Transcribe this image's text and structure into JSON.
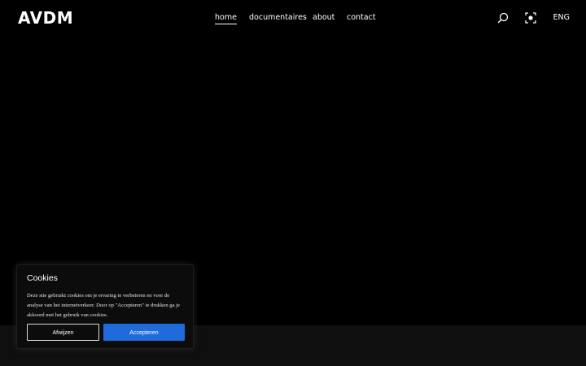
{
  "header": {
    "logo": "AVDM",
    "nav": [
      {
        "label": "home",
        "active": true
      },
      {
        "label": "documentaires",
        "active": false
      },
      {
        "label": "about",
        "active": false
      },
      {
        "label": "contact",
        "active": false
      }
    ],
    "tools": {
      "search_icon": "search-icon",
      "focus_icon": "focus-icon",
      "language": "ENG"
    }
  },
  "cookie": {
    "title": "Cookies",
    "text": "Deze site gebruikt cookies om je ervaring te verbeteren en voor de analyse van het internetverkeer. Door op \"Accepteren\" te drukken ga je akkoord met het gebruik van cookies.",
    "decline_label": "Afwijzen",
    "accept_label": "Accepteren"
  },
  "colors": {
    "background": "#000000",
    "footer_band": "#0f0f0f",
    "accent": "#1f6bdc",
    "text": "#ffffff"
  }
}
